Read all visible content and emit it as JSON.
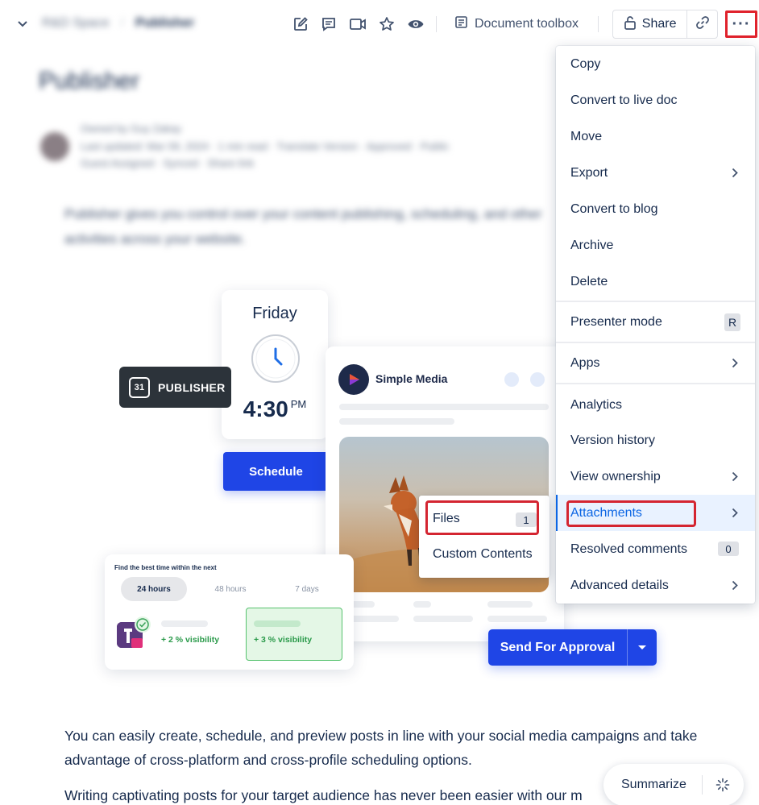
{
  "header": {
    "breadcrumb": [
      "R&D Space",
      "Publisher"
    ],
    "doc_toolbox_label": "Document toolbox",
    "share_label": "Share",
    "more_label": "···"
  },
  "page": {
    "title": "Publisher",
    "byline_line1": "Owned by Guy Zakay",
    "byline_line2": "Last updated: Mar 09, 2024 · 1 min read · Translate Version · Approved · Public",
    "byline_line3": "Guest Assigned · Synced · Share link",
    "intro": "Publisher gives you control over your content publishing, scheduling, and other activities across your website.",
    "para1": "You can easily create, schedule, and preview posts in line with your social media campaigns and take advantage of cross-platform and cross-profile scheduling options.",
    "para2": "Writing captivating posts for your target audience has never been easier with our m"
  },
  "illustration": {
    "day": "Friday",
    "time": "4:30",
    "ampm": "PM",
    "badge_num": "31",
    "badge_label": "PUBLISHER",
    "schedule_label": "Schedule",
    "media_name": "Simple Media",
    "best_time_heading": "Find the best time within the next",
    "ranges": [
      "24 hours",
      "48 hours",
      "7 days"
    ],
    "vis_a": "+ 2 % visibility",
    "vis_b": "+ 3 % visibility",
    "approval_label": "Send For Approval"
  },
  "files_menu": {
    "items": [
      {
        "label": "Files",
        "count": "1"
      },
      {
        "label": "Custom Contents"
      }
    ]
  },
  "menu": {
    "items": [
      {
        "label": "Copy"
      },
      {
        "label": "Convert to live doc"
      },
      {
        "label": "Move"
      },
      {
        "label": "Export"
      },
      {
        "label": "Convert to blog"
      },
      {
        "label": "Archive"
      },
      {
        "label": "Delete"
      },
      {
        "label": "Presenter mode",
        "shortcut": "R"
      },
      {
        "label": "Apps"
      },
      {
        "label": "Analytics"
      },
      {
        "label": "Version history"
      },
      {
        "label": "View ownership"
      },
      {
        "label": "Attachments"
      },
      {
        "label": "Resolved comments",
        "count": "0"
      },
      {
        "label": "Advanced details"
      }
    ]
  },
  "summarize_label": "Summarize",
  "colors": {
    "accent": "#1f45e6",
    "highlight_red": "#d42531",
    "selected_text": "#0c66e4"
  }
}
